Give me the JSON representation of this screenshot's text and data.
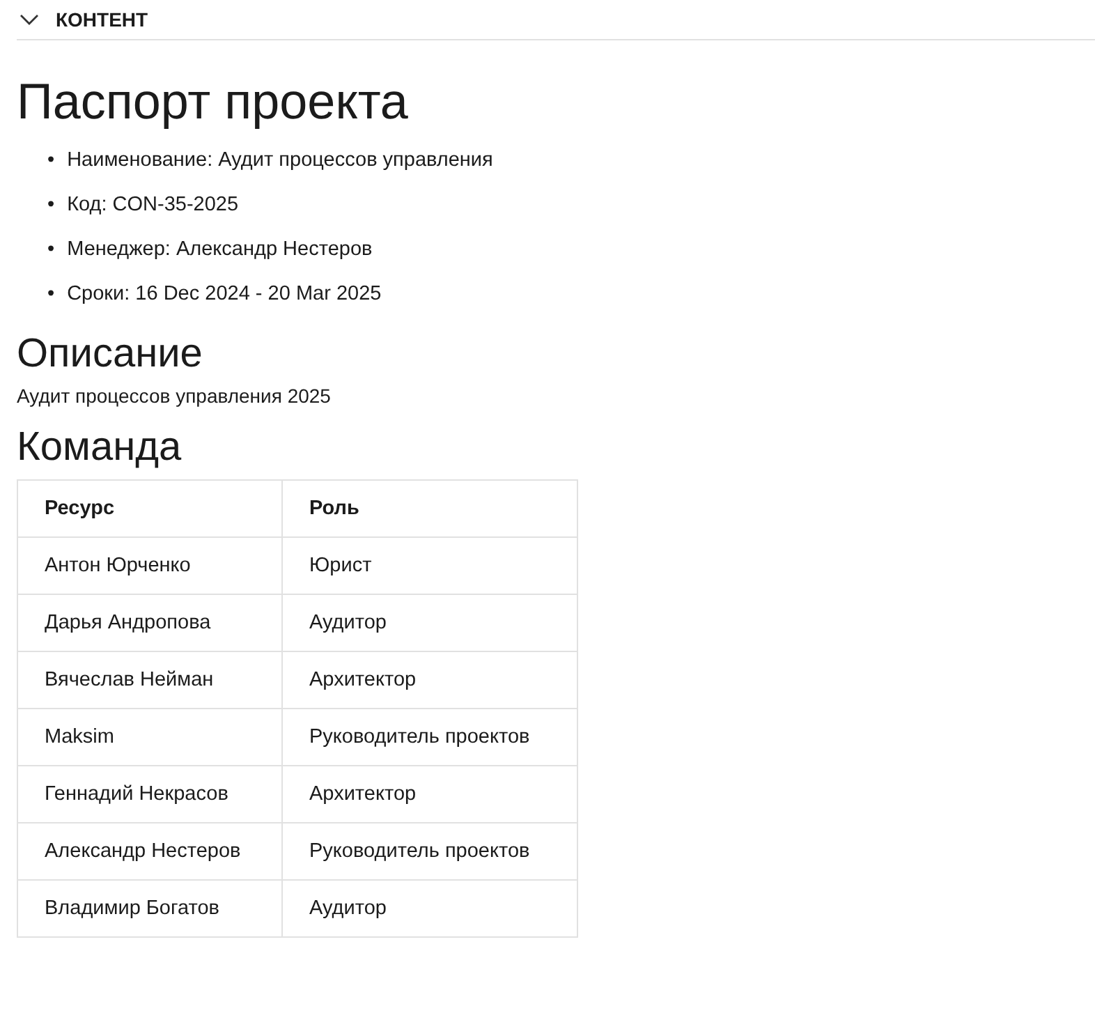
{
  "section": {
    "title": "КОНТЕНТ",
    "expanded": true
  },
  "title": "Паспорт проекта",
  "details": [
    {
      "marker": "•",
      "text": "Наименование: Аудит процессов управления"
    },
    {
      "marker": "•",
      "text": "Код: CON-35-2025"
    },
    {
      "marker": "•",
      "text": "Менеджер: Александр Нестеров"
    },
    {
      "marker": "•",
      "text": "Сроки: 16 Dec 2024 - 20 Mar 2025"
    }
  ],
  "description": {
    "heading": "Описание",
    "text": "Аудит процессов управления 2025"
  },
  "team": {
    "heading": "Команда",
    "columns": [
      "Ресурс",
      "Роль"
    ],
    "rows": [
      [
        "Антон Юрченко",
        "Юрист"
      ],
      [
        "Дарья Андропова",
        "Аудитор"
      ],
      [
        "Вячеслав Нейман",
        "Архитектор"
      ],
      [
        "Maksim",
        "Руководитель проектов"
      ],
      [
        "Геннадий Некрасов",
        "Архитектор"
      ],
      [
        "Александр Нестеров",
        "Руководитель проектов"
      ],
      [
        "Владимир Богатов",
        "Аудитор"
      ]
    ]
  }
}
